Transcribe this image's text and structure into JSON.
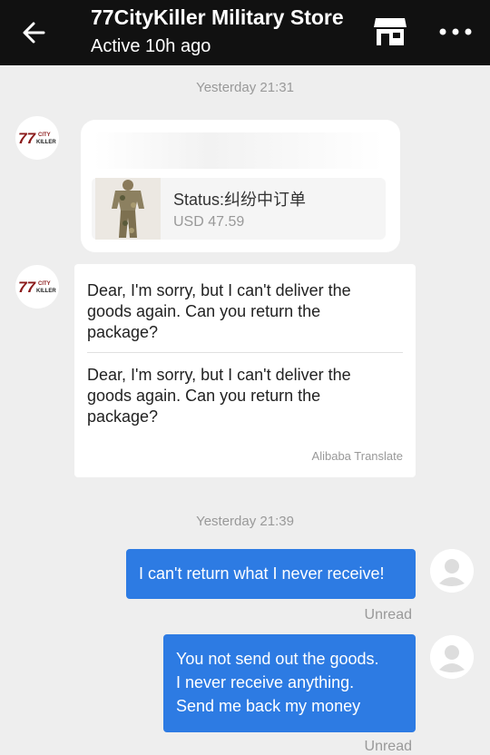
{
  "header": {
    "title": "77CityKiller Military Store",
    "status": "Active 10h ago",
    "back_icon": "arrow-left-icon",
    "store_icon": "storefront-icon",
    "more_icon": "more-horizontal-icon"
  },
  "colors": {
    "header_bg": "#111111",
    "chat_bg": "#eeeeee",
    "outgoing_bubble": "#2d7be3",
    "muted_text": "#999999"
  },
  "avatar_store": {
    "logo_number": "77",
    "logo_line1": "CITY",
    "logo_line2": "KILLER"
  },
  "messages": [
    {
      "type": "timestamp",
      "text": "Yesterday 21:31"
    },
    {
      "type": "order_card",
      "status": "Status:纠纷中订单",
      "price": "USD 47.59"
    },
    {
      "type": "incoming_text",
      "original": "Dear, I'm sorry, but I can't deliver the goods again. Can you return the package?",
      "translated": "Dear, I'm sorry, but I can't deliver the goods again. Can you return the package?",
      "translator": "Alibaba Translate"
    },
    {
      "type": "timestamp",
      "text": "Yesterday 21:39"
    },
    {
      "type": "outgoing_text",
      "lines": [
        "I can't return what I never receive!"
      ],
      "read_status": "Unread"
    },
    {
      "type": "outgoing_text",
      "lines": [
        "You not send out the goods.",
        "I never receive anything.",
        "Send me back my money"
      ],
      "read_status": "Unread"
    }
  ]
}
